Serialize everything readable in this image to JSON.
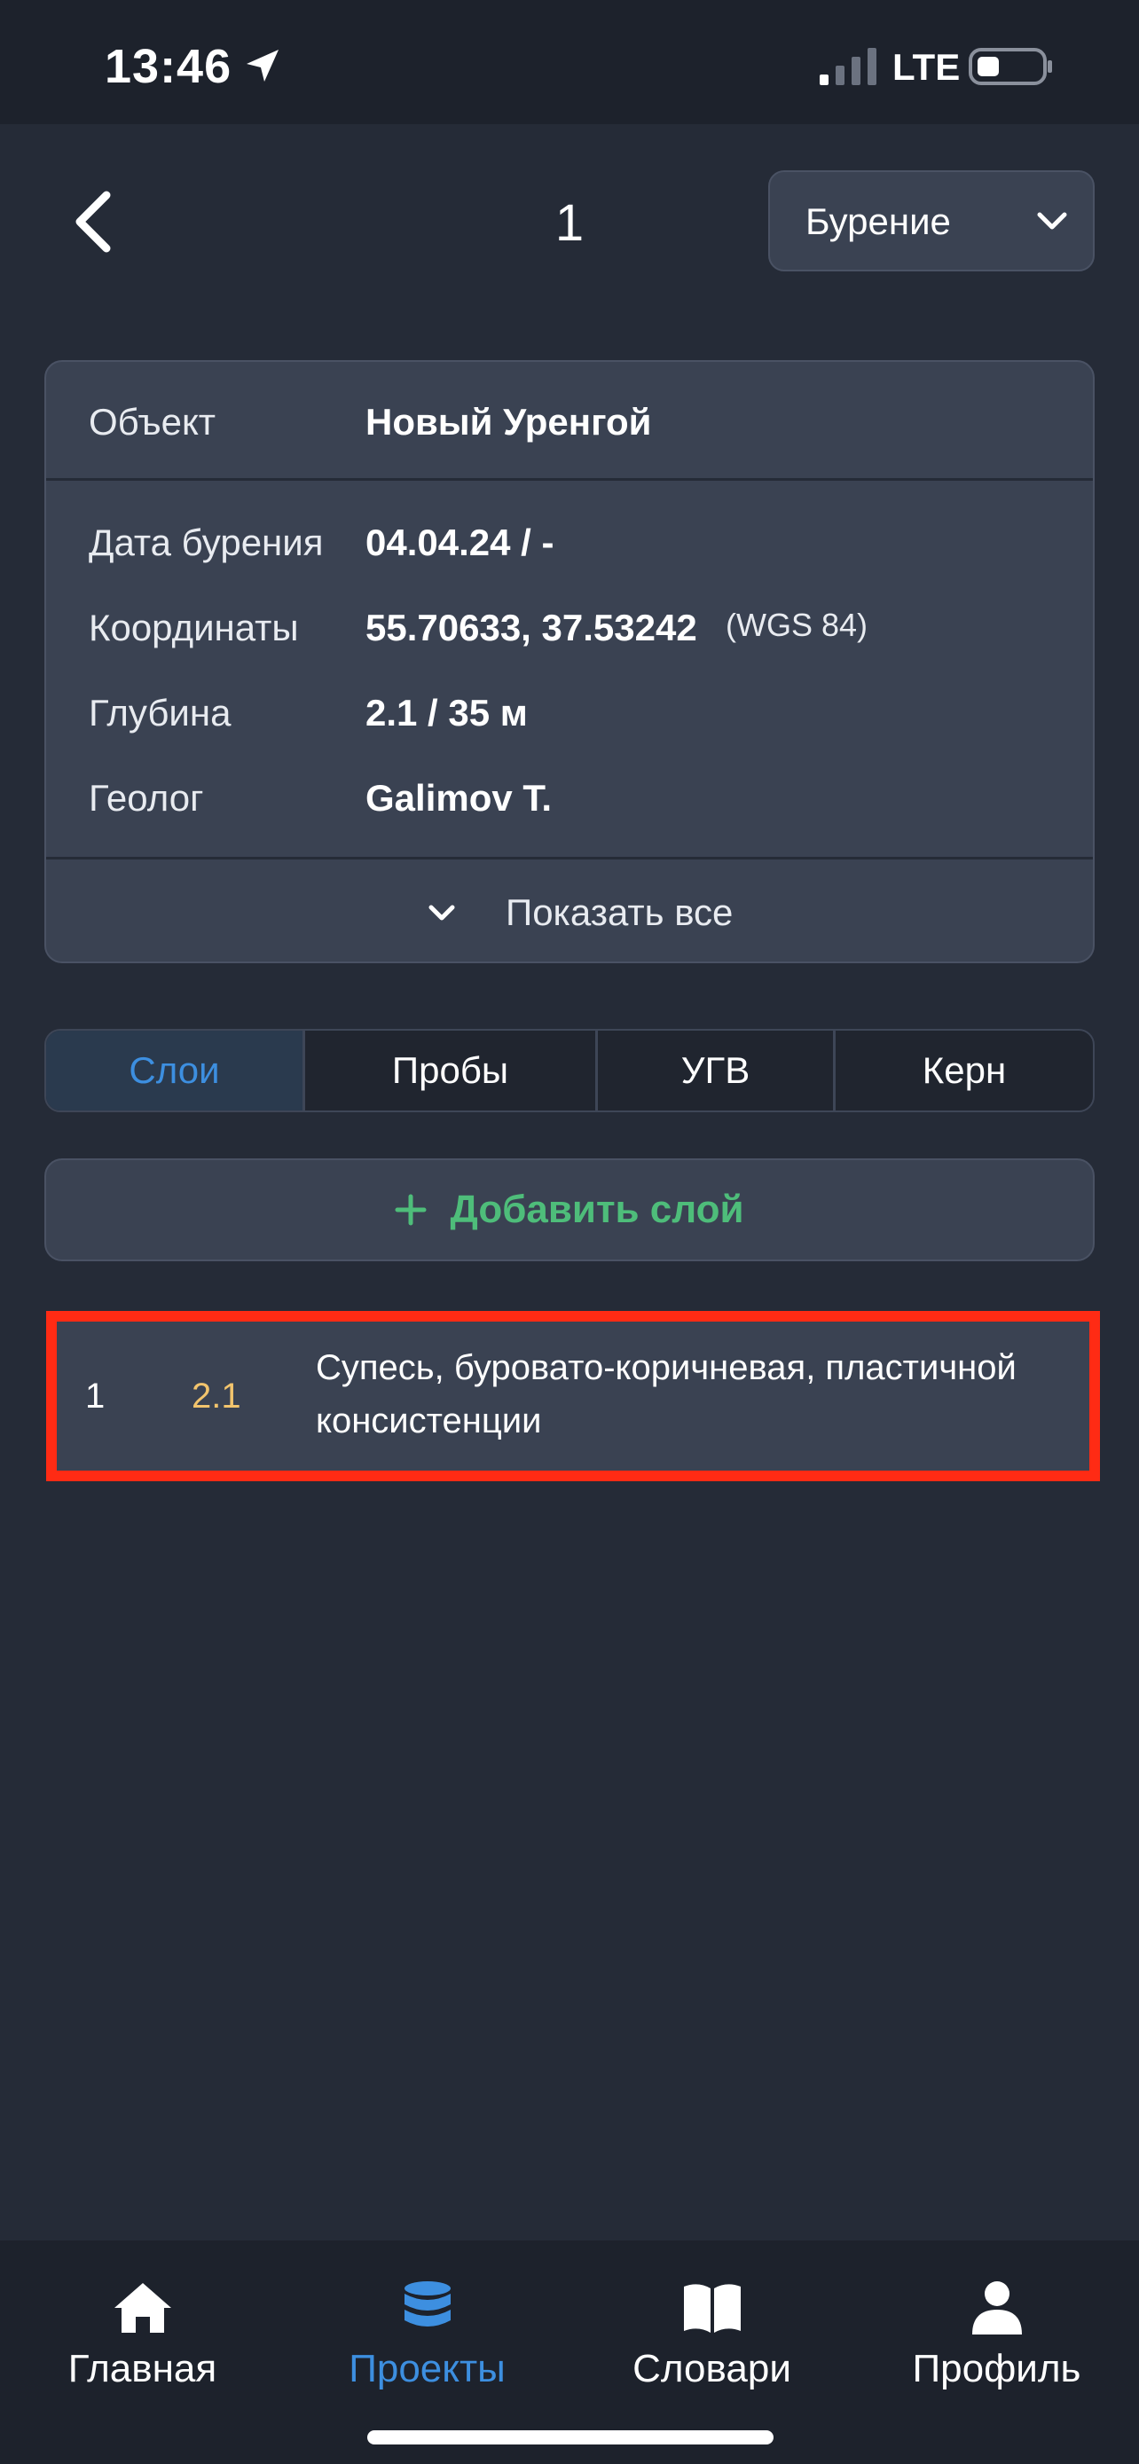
{
  "status_bar": {
    "time": "13:46",
    "network": "LTE",
    "icons": [
      "location-arrow-icon",
      "signal-bars-icon",
      "battery-icon"
    ]
  },
  "header": {
    "title": "1",
    "back_icon": "chevron-left-icon",
    "mode_dropdown": {
      "selected": "Бурение",
      "icon": "chevron-down-icon"
    }
  },
  "info": {
    "object": {
      "label": "Объект",
      "value": "Новый Уренгой"
    },
    "drill_date": {
      "label": "Дата бурения",
      "value": "04.04.24 / -"
    },
    "coordinates": {
      "label": "Координаты",
      "value": "55.70633, 37.53242",
      "datum": "(WGS 84)"
    },
    "depth": {
      "label": "Глубина",
      "value": "2.1 / 35 м"
    },
    "geologist": {
      "label": "Геолог",
      "value": "Galimov T."
    },
    "show_all": "Показать все"
  },
  "tabs": [
    {
      "label": "Слои",
      "active": true
    },
    {
      "label": "Пробы",
      "active": false
    },
    {
      "label": "УГВ",
      "active": false
    },
    {
      "label": "Керн",
      "active": false
    }
  ],
  "add_layer": {
    "icon": "plus-icon",
    "label": "Добавить слой"
  },
  "layers": [
    {
      "number": "1",
      "depth": "2.1",
      "description": "Супесь, буровато-коричневая, пластичной консистенции"
    }
  ],
  "bottom_nav": [
    {
      "label": "Главная",
      "icon": "home-icon",
      "active": false
    },
    {
      "label": "Проекты",
      "icon": "database-icon",
      "active": true
    },
    {
      "label": "Словари",
      "icon": "book-icon",
      "active": false
    },
    {
      "label": "Профиль",
      "icon": "user-icon",
      "active": false
    }
  ],
  "colors": {
    "background": "#252b37",
    "card": "#3a4252",
    "accent_blue": "#3d8fe0",
    "accent_green": "#4ebd7a",
    "depth_yellow": "#f2c46d",
    "highlight_red": "#ff2b14"
  }
}
